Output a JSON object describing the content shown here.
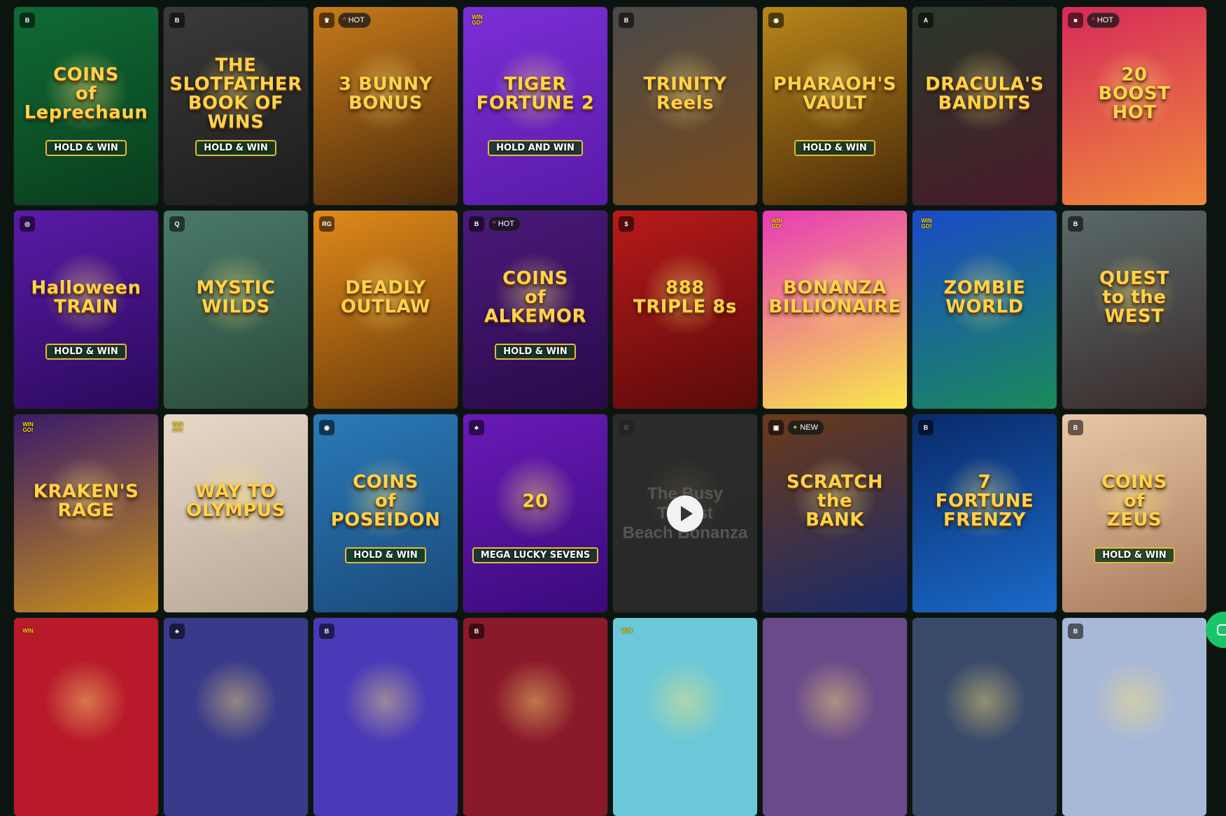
{
  "rows": [
    [
      {
        "title": "COINS\nof\nLeprechaun",
        "subtitle": "HOLD & WIN",
        "provider": "B",
        "bg": "#0f6b35",
        "bg2": "#0a3d1e"
      },
      {
        "title": "THE SLOTFATHER\nBOOK OF WINS",
        "subtitle": "HOLD & WIN",
        "provider": "B",
        "bg": "#3a3a3a",
        "bg2": "#1c1c1c"
      },
      {
        "title": "3 BUNNY\nBONUS",
        "subtitle": "",
        "provider": "♛",
        "tag": {
          "icon": "^",
          "label": "HOT"
        },
        "bg": "#c77a1a",
        "bg2": "#4a2a0a"
      },
      {
        "title": "TIGER FORTUNE 2",
        "subtitle": "HOLD AND WIN",
        "provider": "WIN GO!",
        "provider_type": "win",
        "bg": "#7b2fd6",
        "bg2": "#5a1aa8"
      },
      {
        "title": "TRINITY\nReels",
        "subtitle": "",
        "provider": "B",
        "bg": "#4a4a4a",
        "bg2": "#7a4a1a"
      },
      {
        "title": "PHARAOH'S\nVAULT",
        "subtitle": "HOLD & WIN",
        "provider": "◉",
        "bg": "#b8861a",
        "bg2": "#4a2a08"
      },
      {
        "title": "DRACULA'S\nBANDITS",
        "subtitle": "",
        "provider": "A",
        "bg": "#2a3a2a",
        "bg2": "#4a1a2a"
      },
      {
        "title": "20\nBOOST\nHOT",
        "subtitle": "",
        "provider": "■",
        "tag": {
          "icon": "^",
          "label": "HOT"
        },
        "bg": "#d62a5a",
        "bg2": "#f08a3a"
      }
    ],
    [
      {
        "title": "Halloween\nTRAIN",
        "subtitle": "HOLD & WIN",
        "provider": "◎",
        "bg": "#5a1aa8",
        "bg2": "#2a0a5a"
      },
      {
        "title": "MYSTIC\nWILDS",
        "subtitle": "",
        "provider": "Q",
        "bg": "#4a7a6a",
        "bg2": "#2a4a3a"
      },
      {
        "title": "DEADLY\nOUTLAW",
        "subtitle": "",
        "provider": "RG",
        "bg": "#e08a1a",
        "bg2": "#6a3a0a"
      },
      {
        "title": "COINS\nof\nALKEMOR",
        "subtitle": "HOLD & WIN",
        "provider": "B",
        "tag": {
          "icon": "^",
          "label": "HOT"
        },
        "bg": "#4a1a7a",
        "bg2": "#2a0a4a"
      },
      {
        "title": "888\nTRIPLE 8s",
        "subtitle": "",
        "provider": "$",
        "bg": "#b81a1a",
        "bg2": "#5a0a0a"
      },
      {
        "title": "BONANZA\nBILLIONAIRE",
        "subtitle": "",
        "provider": "WIN GO!",
        "provider_type": "win",
        "bg": "#e83ab8",
        "bg2": "#f8e84a"
      },
      {
        "title": "ZOMBIE\nWORLD",
        "subtitle": "",
        "provider": "WIN GO!",
        "provider_type": "win",
        "bg": "#1a4ac8",
        "bg2": "#1a8a5a"
      },
      {
        "title": "QUEST\nto the\nWEST",
        "subtitle": "",
        "provider": "B",
        "bg": "#5a6a6a",
        "bg2": "#3a2a2a"
      }
    ],
    [
      {
        "title": "KRAKEN'S\nRAGE",
        "subtitle": "",
        "provider": "WIN GO!",
        "provider_type": "win",
        "bg": "#3a1a6a",
        "bg2": "#c8901a"
      },
      {
        "title": "WAY TO\nOLYMPUS",
        "subtitle": "",
        "provider": "WIN GO!",
        "provider_type": "win",
        "bg": "#e8d8c8",
        "bg2": "#b8a898"
      },
      {
        "title": "COINS\nof\nPOSEIDON",
        "subtitle": "HOLD & WIN",
        "provider": "◉",
        "bg": "#2a7ab8",
        "bg2": "#1a4a7a"
      },
      {
        "title": "20",
        "subtitle": "MEGA LUCKY SEVENS",
        "provider": "♣",
        "bg": "#6a1ab8",
        "bg2": "#3a0a7a"
      },
      {
        "title": "The Busy\nTourist\nBeach Bonanza",
        "subtitle": "",
        "provider": "B",
        "dim": true,
        "bg": "#3a3a3a",
        "bg2": "#2a2a2a"
      },
      {
        "title": "SCRATCH\nthe\nBANK",
        "subtitle": "",
        "provider": "▣",
        "tag": {
          "icon": "✦",
          "label": "NEW"
        },
        "bg": "#6a3a1a",
        "bg2": "#1a2a6a"
      },
      {
        "title": "7\nFORTUNE\nFRENZY",
        "subtitle": "",
        "provider": "B",
        "bg": "#0a2a6a",
        "bg2": "#1a6ac8"
      },
      {
        "title": "COINS\nof\nZEUS",
        "subtitle": "HOLD & WIN",
        "provider": "B",
        "bg": "#e8c8a8",
        "bg2": "#a87a5a"
      }
    ],
    [
      {
        "title": "",
        "subtitle": "",
        "provider": "WIN",
        "provider_type": "win",
        "bg": "#b81a2a",
        "bg2": "#b81a2a"
      },
      {
        "title": "",
        "subtitle": "",
        "provider": "♣",
        "bg": "#3a3a8a",
        "bg2": "#3a3a8a"
      },
      {
        "title": "",
        "subtitle": "",
        "provider": "B",
        "bg": "#4a3ab8",
        "bg2": "#4a3ab8"
      },
      {
        "title": "",
        "subtitle": "",
        "provider": "B",
        "bg": "#8a1a2a",
        "bg2": "#8a1a2a"
      },
      {
        "title": "",
        "subtitle": "",
        "provider": "WIN",
        "provider_type": "win",
        "bg": "#6ac8d8",
        "bg2": "#6ac8d8"
      },
      {
        "title": "",
        "subtitle": "",
        "provider": "",
        "bg": "#6a4a8a",
        "bg2": "#6a4a8a"
      },
      {
        "title": "",
        "subtitle": "",
        "provider": "",
        "bg": "#3a4a6a",
        "bg2": "#3a4a6a"
      },
      {
        "title": "",
        "subtitle": "",
        "provider": "B",
        "bg": "#a8b8d8",
        "bg2": "#a8b8d8"
      }
    ]
  ],
  "chat_button_icon": "chat-icon"
}
